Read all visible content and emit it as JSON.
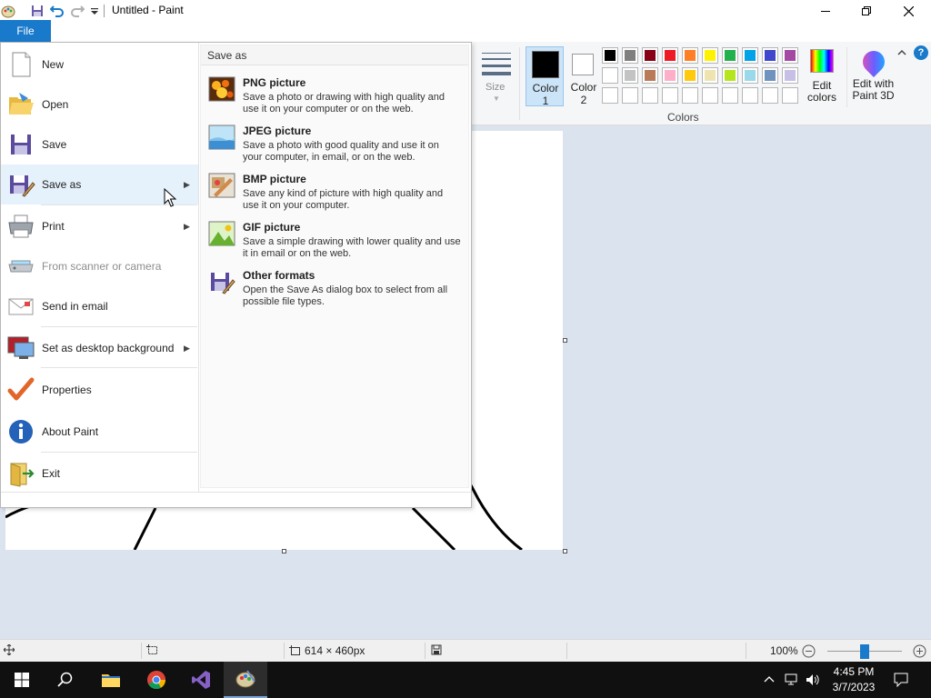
{
  "window": {
    "title": "Untitled - Paint"
  },
  "ribbon": {
    "file_tab": "File",
    "size_label": "Size",
    "color1_label": [
      "Color",
      "1"
    ],
    "color2_label": [
      "Color",
      "2"
    ],
    "colors_group_label": "Colors",
    "edit_colors_label": [
      "Edit",
      "colors"
    ],
    "paint3d_label": [
      "Edit with",
      "Paint 3D"
    ],
    "help": "?",
    "palette_row1": [
      "#000000",
      "#7f7f7f",
      "#880015",
      "#ed1c24",
      "#ff7f27",
      "#fff200",
      "#22b14c",
      "#00a2e8",
      "#3f48cc",
      "#a349a4"
    ],
    "palette_row2": [
      "#ffffff",
      "#c3c3c3",
      "#b97a57",
      "#ffaec9",
      "#ffc90e",
      "#efe4b0",
      "#b5e61d",
      "#99d9ea",
      "#7092be",
      "#c8bfe7"
    ],
    "color1": "#000000",
    "color2": "#ffffff",
    "accent": "#1979ca"
  },
  "file_menu": {
    "items": [
      {
        "label": "New",
        "icon": "new-file-icon",
        "has_submenu": false,
        "enabled": true
      },
      {
        "label": "Open",
        "icon": "open-folder-icon",
        "has_submenu": false,
        "enabled": true
      },
      {
        "label": "Save",
        "icon": "save-icon",
        "has_submenu": false,
        "enabled": true
      },
      {
        "label": "Save as",
        "icon": "save-as-icon",
        "has_submenu": true,
        "enabled": true
      },
      {
        "label": "Print",
        "icon": "printer-icon",
        "has_submenu": true,
        "enabled": true
      },
      {
        "label": "From scanner or camera",
        "icon": "scanner-icon",
        "has_submenu": false,
        "enabled": false
      },
      {
        "label": "Send in email",
        "icon": "email-icon",
        "has_submenu": false,
        "enabled": true
      },
      {
        "label": "Set as desktop background",
        "icon": "desktop-icon",
        "has_submenu": true,
        "enabled": true
      },
      {
        "label": "Properties",
        "icon": "checkmark-icon",
        "has_submenu": false,
        "enabled": true
      },
      {
        "label": "About Paint",
        "icon": "info-icon",
        "has_submenu": false,
        "enabled": true
      },
      {
        "label": "Exit",
        "icon": "exit-icon",
        "has_submenu": false,
        "enabled": true
      }
    ],
    "save_as": {
      "title": "Save as",
      "options": [
        {
          "name": "PNG picture",
          "desc": "Save a photo or drawing with high quality and use it on your computer or on the web.",
          "icon": "png-picture-icon"
        },
        {
          "name": "JPEG picture",
          "desc": "Save a photo with good quality and use it on your computer, in email, or on the web.",
          "icon": "jpeg-picture-icon"
        },
        {
          "name": "BMP picture",
          "desc": "Save any kind of picture with high quality and use it on your computer.",
          "icon": "bmp-picture-icon"
        },
        {
          "name": "GIF picture",
          "desc": "Save a simple drawing with lower quality and use it in email or on the web.",
          "icon": "gif-picture-icon"
        },
        {
          "name": "Other formats",
          "desc": "Open the Save As dialog box to select from all possible file types.",
          "icon": "other-formats-icon"
        }
      ]
    }
  },
  "statusbar": {
    "canvas_size": "614 × 460px",
    "zoom": "100%"
  },
  "taskbar": {
    "time": "4:45 PM",
    "date": "3/7/2023"
  }
}
